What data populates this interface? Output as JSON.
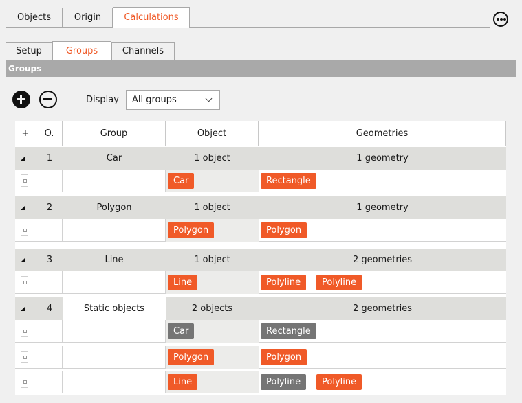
{
  "top_tabs": [
    {
      "label": "Objects",
      "active": false
    },
    {
      "label": "Origin",
      "active": false
    },
    {
      "label": "Calculations",
      "active": true
    }
  ],
  "sub_tabs": [
    {
      "label": "Setup",
      "active": false
    },
    {
      "label": "Groups",
      "active": true
    },
    {
      "label": "Channels",
      "active": false
    }
  ],
  "section_title": "Groups",
  "toolbar": {
    "add_icon": "plus-circle-icon",
    "remove_icon": "minus-circle-icon",
    "display_label": "Display",
    "display_value": "All groups"
  },
  "table": {
    "columns": [
      "+",
      "O.",
      "Group",
      "Object",
      "Geometries"
    ],
    "groups": [
      {
        "order": "1",
        "name": "Car",
        "objects": "1 object",
        "geometries": "1 geometry",
        "rows": [
          {
            "object": "Car",
            "object_active": true,
            "geoms": [
              {
                "label": "Rectangle",
                "active": true
              }
            ]
          }
        ]
      },
      {
        "order": "2",
        "name": "Polygon",
        "objects": "1 object",
        "geometries": "1 geometry",
        "rows": [
          {
            "object": "Polygon",
            "object_active": true,
            "geoms": [
              {
                "label": "Polygon",
                "active": true
              }
            ]
          }
        ]
      },
      {
        "order": "3",
        "name": "Line",
        "objects": "1 object",
        "geometries": "2 geometries",
        "rows": [
          {
            "object": "Line",
            "object_active": true,
            "geoms": [
              {
                "label": "Polyline",
                "active": true
              },
              {
                "label": "Polyline",
                "active": true
              }
            ]
          }
        ]
      },
      {
        "order": "4",
        "name": "Static objects",
        "objects": "2 objects",
        "geometries": "2 geometries",
        "rows": [
          {
            "object": "Car",
            "object_active": false,
            "geoms": [
              {
                "label": "Rectangle",
                "active": false
              }
            ]
          },
          {
            "object": "Polygon",
            "object_active": true,
            "geoms": [
              {
                "label": "Polygon",
                "active": true
              }
            ]
          },
          {
            "object": "Line",
            "object_active": true,
            "geoms": [
              {
                "label": "Polyline",
                "active": false
              },
              {
                "label": "Polyline",
                "active": true
              }
            ]
          }
        ]
      }
    ]
  },
  "colors": {
    "accent": "#f05a28",
    "inactive_chip": "#757575",
    "section_bar": "#a9a9a9",
    "group_row": "#dededb"
  }
}
